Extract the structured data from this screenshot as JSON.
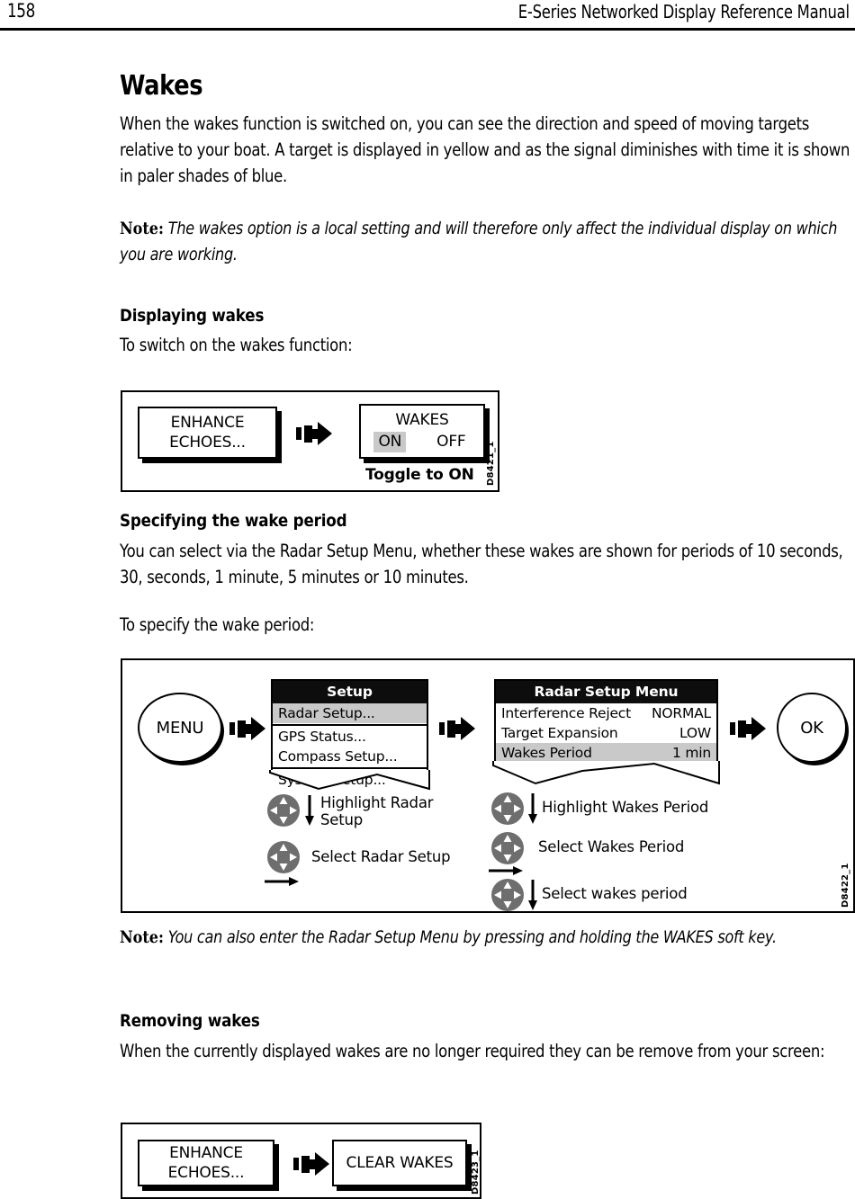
{
  "header": {
    "page_number": "158",
    "manual_title": "E-Series Networked Display Reference Manual"
  },
  "section": {
    "title": "Wakes",
    "intro": "When the wakes function is switched on, you can see the direction and speed of moving targets relative to your boat. A target is displayed in yellow and as the signal diminishes with time it is shown in paler shades of blue.",
    "note_lead": "Note:",
    "note_body": "The wakes option is a local setting and will therefore only affect the individual display on which you are working."
  },
  "displaying": {
    "heading": "Displaying wakes",
    "lead_in": "To switch on the wakes function:",
    "figure": {
      "id": "D8421_1",
      "softkey_1": {
        "line1": "ENHANCE",
        "line2": "ECHOES..."
      },
      "wakes_panel": {
        "title": "WAKES",
        "option_on": "ON",
        "option_off": "OFF"
      },
      "caption": "Toggle to ON"
    }
  },
  "specifying": {
    "heading": "Specifying the wake period",
    "body": "You can select via the Radar Setup Menu, whether these wakes are shown for periods of 10 seconds, 30, seconds, 1 minute, 5 minutes or 10 minutes.",
    "lead_in": "To specify the wake period:",
    "figure": {
      "id": "D8422_1",
      "menu_key": "MENU",
      "ok_key": "OK",
      "setup_menu": {
        "title": "Setup",
        "items": [
          {
            "label": "Radar Setup...",
            "highlighted": true
          },
          {
            "label": "GPS Status...",
            "highlighted": false
          },
          {
            "label": "Compass Setup...",
            "highlighted": false
          },
          {
            "label": "System Setup...",
            "highlighted": false
          }
        ]
      },
      "radar_setup_menu": {
        "title": "Radar Setup Menu",
        "rows": [
          {
            "label": "Interference Reject",
            "value": "NORMAL",
            "highlighted": false
          },
          {
            "label": "Target Expansion",
            "value": "LOW",
            "highlighted": false
          },
          {
            "label": "Wakes Period",
            "value": "1 min",
            "highlighted": true
          }
        ]
      },
      "left_steps": [
        {
          "label": "Highlight Radar\nSetup",
          "direction": "down"
        },
        {
          "label": "Select Radar Setup",
          "direction": "right"
        }
      ],
      "right_steps": [
        {
          "label": "Highlight Wakes Period",
          "direction": "down"
        },
        {
          "label": "Select Wakes Period",
          "direction": "right"
        },
        {
          "label": "Select wakes period",
          "direction": "down"
        }
      ]
    },
    "note_lead": "Note:",
    "note_body": "You can also enter the Radar Setup Menu by pressing and holding the WAKES soft key."
  },
  "removing": {
    "heading": "Removing wakes",
    "body": "When the currently displayed wakes are no longer required they can be remove from your screen:",
    "figure": {
      "id": "D8423_1",
      "softkey_1": {
        "line1": "ENHANCE",
        "line2": "ECHOES..."
      },
      "softkey_2": {
        "line1": "CLEAR WAKES"
      }
    }
  },
  "colors": {
    "highlight_gray": "#c9c9c9",
    "trackpad_gray": "#6e6e6e",
    "menu_header_black": "#0d0d0d"
  },
  "icons": {
    "flow_arrow": "flow-arrow-icon",
    "trackpad": "trackpad-icon",
    "down_arrow": "down-arrow-icon",
    "right_arrow": "right-arrow-icon"
  }
}
